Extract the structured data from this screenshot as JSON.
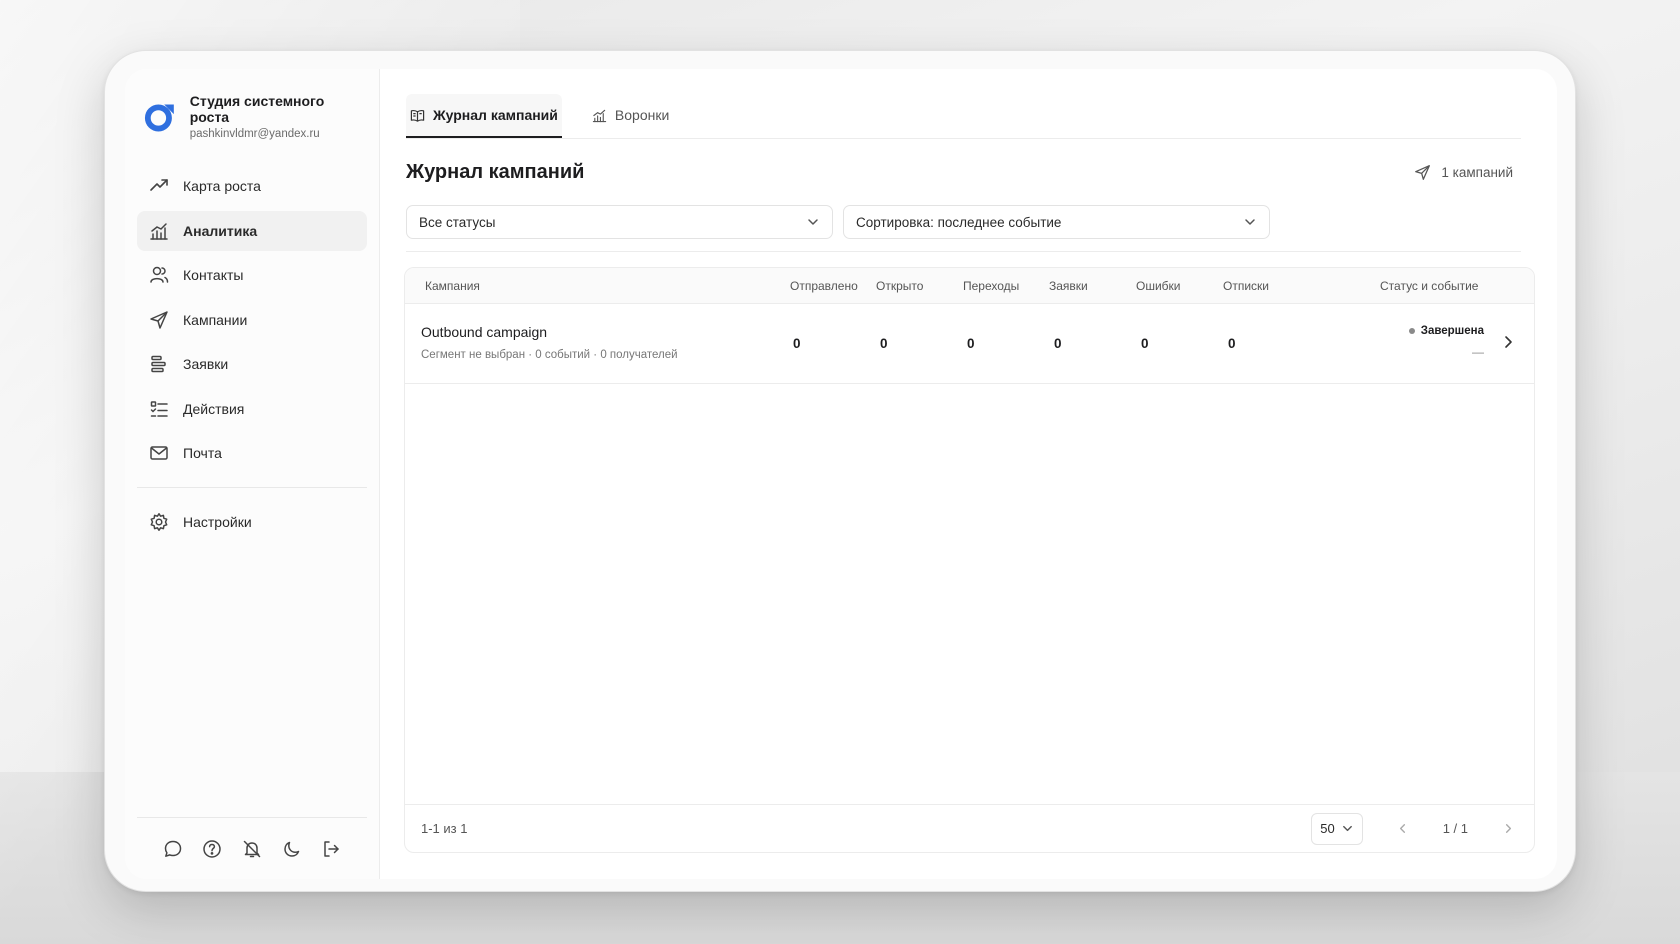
{
  "brand": {
    "name": "Студия системного роста",
    "email": "pashkinvldmr@yandex.ru",
    "accent": "#2f6fdf"
  },
  "sidebar": {
    "items": [
      {
        "label": "Карта роста",
        "icon": "trend-up-icon"
      },
      {
        "label": "Аналитика",
        "icon": "chart-icon",
        "active": true
      },
      {
        "label": "Контакты",
        "icon": "users-icon"
      },
      {
        "label": "Кампании",
        "icon": "send-icon"
      },
      {
        "label": "Заявки",
        "icon": "list-icon"
      },
      {
        "label": "Действия",
        "icon": "checklist-icon"
      },
      {
        "label": "Почта",
        "icon": "mail-icon"
      }
    ],
    "settings": {
      "label": "Настройки",
      "icon": "gear-icon"
    },
    "bottom_icons": [
      "chat-icon",
      "help-icon",
      "bell-off-icon",
      "moon-icon",
      "logout-icon"
    ]
  },
  "tabs": [
    {
      "label": "Журнал кампаний",
      "icon": "book-icon",
      "active": true
    },
    {
      "label": "Воронки",
      "icon": "chart-icon"
    }
  ],
  "page": {
    "title": "Журнал кампаний",
    "count_label": "1 кампаний"
  },
  "filters": {
    "status": "Все статусы",
    "sort": "Сортировка: последнее событие"
  },
  "table": {
    "columns": [
      "Кампания",
      "Отправлено",
      "Открыто",
      "Переходы",
      "Заявки",
      "Ошибки",
      "Отписки",
      "Статус и событие"
    ],
    "rows": [
      {
        "name": "Outbound campaign",
        "meta": "Сегмент не выбран · 0 событий · 0 получателей",
        "sent": "0",
        "opened": "0",
        "clicks": "0",
        "leads": "0",
        "errors": "0",
        "unsubscribes": "0",
        "status": "Завершена",
        "event": "—"
      }
    ]
  },
  "footer": {
    "range": "1-1 из 1",
    "per_page": "50",
    "page": "1 / 1"
  }
}
